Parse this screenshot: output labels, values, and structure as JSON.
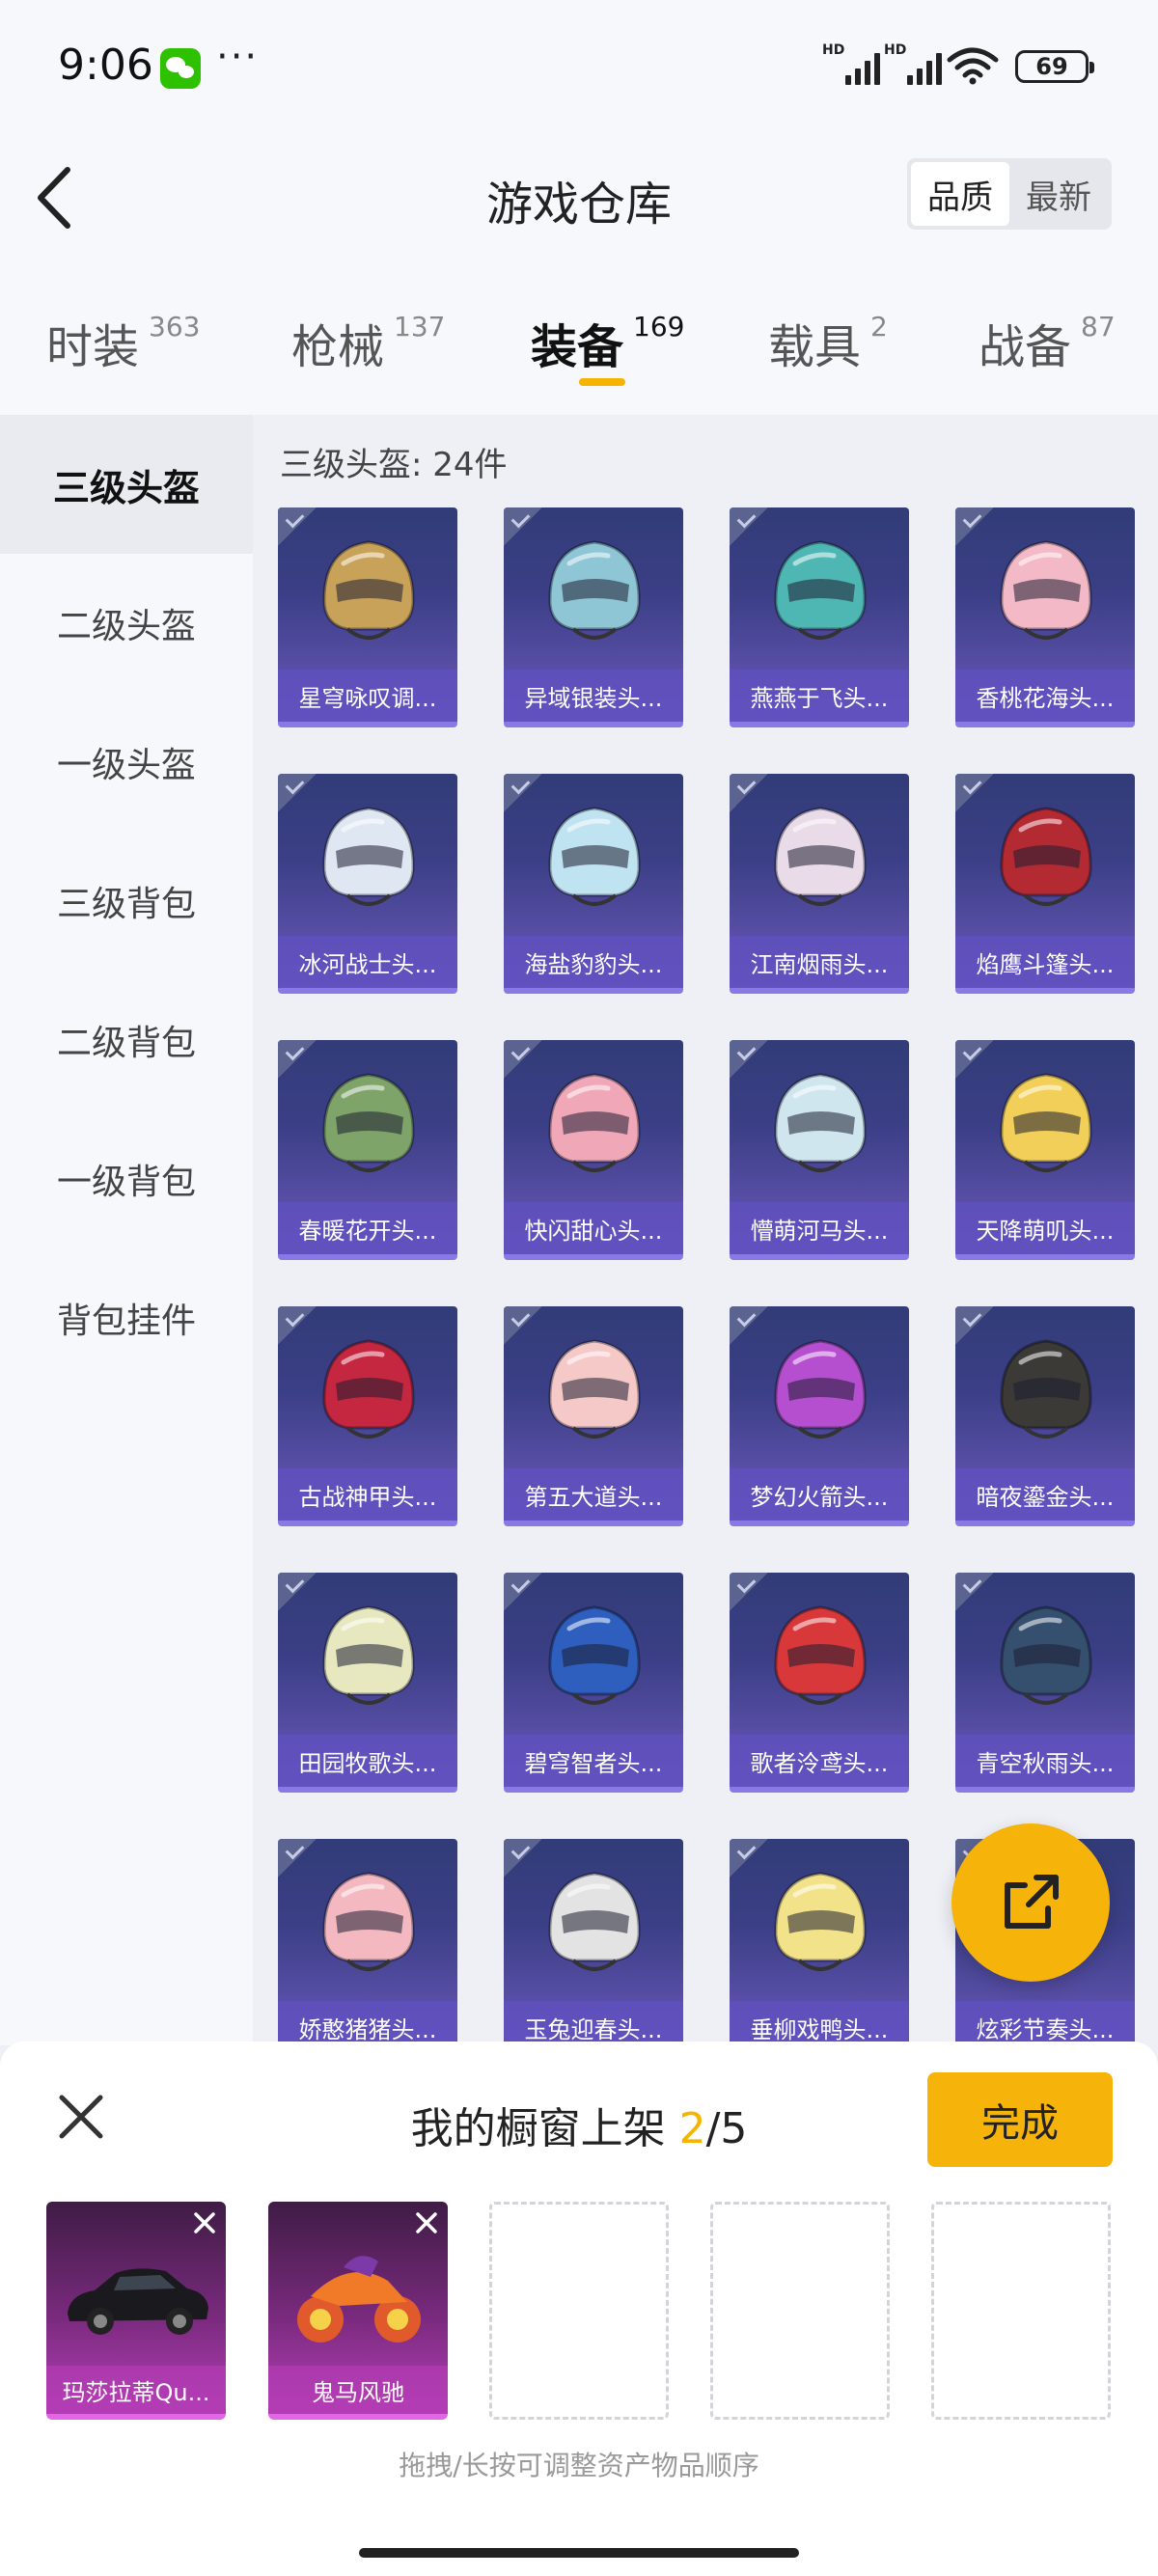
{
  "status_bar": {
    "time": "9:06",
    "more": "···",
    "signal1_label": "HD",
    "signal2_label": "HD",
    "battery": "69",
    "icons": [
      "wechat-icon",
      "wifi-icon",
      "battery-icon",
      "signal-icon"
    ]
  },
  "header": {
    "title": "游戏仓库",
    "sort_options": [
      "品质",
      "最新"
    ],
    "selected_sort": "品质"
  },
  "tabs": [
    {
      "label": "时装",
      "count": "363"
    },
    {
      "label": "枪械",
      "count": "137"
    },
    {
      "label": "装备",
      "count": "169"
    },
    {
      "label": "载具",
      "count": "2"
    },
    {
      "label": "战备",
      "count": "87"
    }
  ],
  "active_tab": "装备",
  "sidebar": {
    "items": [
      "三级头盔",
      "二级头盔",
      "一级头盔",
      "三级背包",
      "二级背包",
      "一级背包",
      "背包挂件"
    ],
    "active": "三级头盔"
  },
  "content": {
    "count_label": "三级头盔: 24件",
    "items": [
      {
        "name": "星穹咏叹调...",
        "color": "#c9a25a"
      },
      {
        "name": "异域银装头...",
        "color": "#8ec6d6"
      },
      {
        "name": "燕燕于飞头...",
        "color": "#4fb7b3"
      },
      {
        "name": "香桃花海头...",
        "color": "#f3b9c6"
      },
      {
        "name": "冰河战士头...",
        "color": "#dfe7f2"
      },
      {
        "name": "海盐豹豹头...",
        "color": "#bfe3f0"
      },
      {
        "name": "江南烟雨头...",
        "color": "#e9dbe8"
      },
      {
        "name": "焰鹰斗篷头...",
        "color": "#b42a33"
      },
      {
        "name": "春暖花开头...",
        "color": "#7fa46a"
      },
      {
        "name": "快闪甜心头...",
        "color": "#f0a8b8"
      },
      {
        "name": "懵萌河马头...",
        "color": "#cfe6ef"
      },
      {
        "name": "天降萌叽头...",
        "color": "#f2cf58"
      },
      {
        "name": "古战神甲头...",
        "color": "#c4273f"
      },
      {
        "name": "第五大道头...",
        "color": "#f6c9c9"
      },
      {
        "name": "梦幻火箭头...",
        "color": "#b54fd0"
      },
      {
        "name": "暗夜鎏金头...",
        "color": "#3b3a36"
      },
      {
        "name": "田园牧歌头...",
        "color": "#e7e8c0"
      },
      {
        "name": "碧穹智者头...",
        "color": "#2e5fbf"
      },
      {
        "name": "歌者泠鸢头...",
        "color": "#d8383a"
      },
      {
        "name": "青空秋雨头...",
        "color": "#35506f"
      },
      {
        "name": "娇憨猪猪头...",
        "color": "#f3b8c0"
      },
      {
        "name": "玉兔迎春头...",
        "color": "#e3e3e3"
      },
      {
        "name": "垂柳戏鸭头...",
        "color": "#f2e28a"
      },
      {
        "name": "炫彩节奏头...",
        "color": "#7a68c8"
      }
    ]
  },
  "share_button": {
    "icon": "share-icon"
  },
  "bottom_panel": {
    "title_prefix": "我的橱窗上架 ",
    "title_count": "2",
    "title_suffix": "/5",
    "done_label": "完成",
    "slots": [
      {
        "name": "玛莎拉蒂Qu...",
        "filled": true
      },
      {
        "name": "鬼马风驰",
        "filled": true
      },
      {
        "name": "",
        "filled": false
      },
      {
        "name": "",
        "filled": false
      },
      {
        "name": "",
        "filled": false
      }
    ],
    "hint": "拖拽/长按可调整资产物品顺序"
  }
}
